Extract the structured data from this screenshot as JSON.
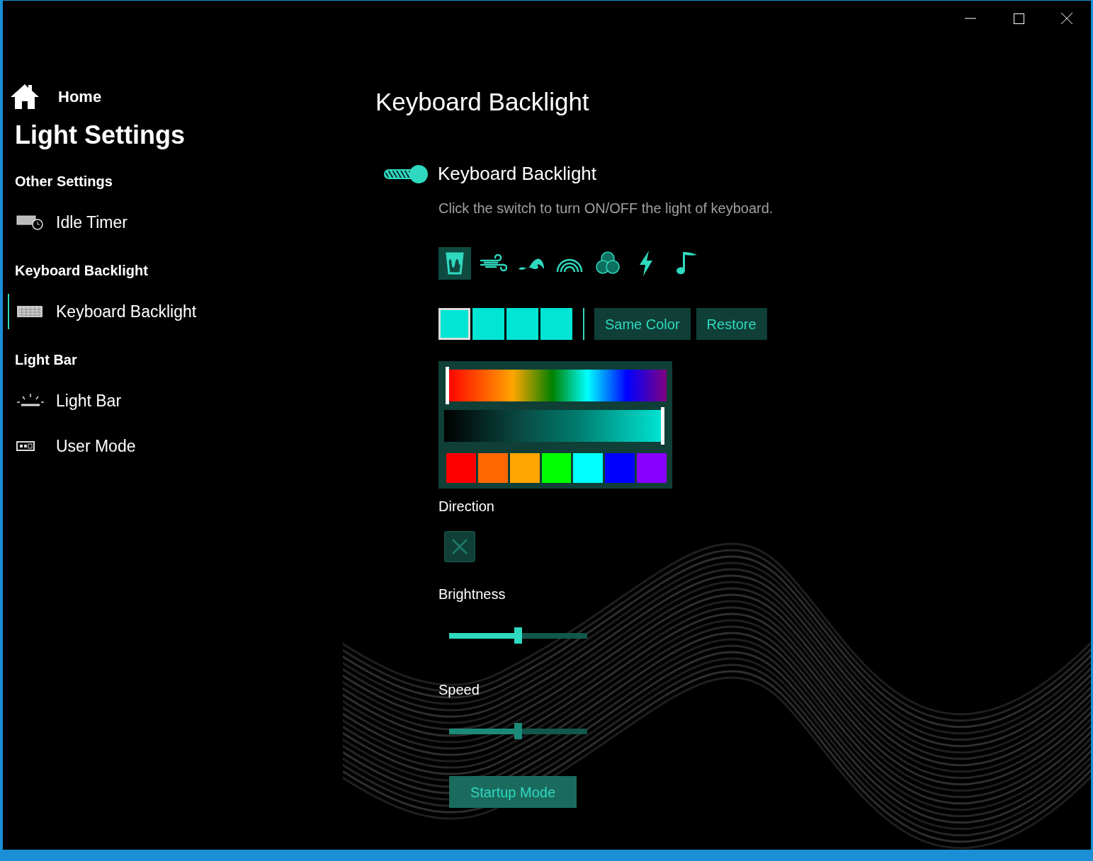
{
  "sidebar": {
    "home": "Home",
    "title": "Light Settings",
    "sections": [
      {
        "heading": "Other Settings",
        "items": [
          {
            "label": "Idle Timer",
            "kind": "timer",
            "selected": false
          }
        ]
      },
      {
        "heading": "Keyboard Backlight",
        "items": [
          {
            "label": "Keyboard Backlight",
            "kind": "keyboard",
            "selected": true
          }
        ]
      },
      {
        "heading": "Light Bar",
        "items": [
          {
            "label": "Light Bar",
            "kind": "lightbar",
            "selected": false
          },
          {
            "label": "User Mode",
            "kind": "usermode",
            "selected": false
          }
        ]
      }
    ]
  },
  "page": {
    "title": "Keyboard Backlight",
    "switch": {
      "label": "Keyboard Backlight",
      "on": true,
      "description": "Click the switch to turn ON/OFF the light of keyboard."
    },
    "effects": [
      {
        "kind": "static",
        "selected": true
      },
      {
        "kind": "wind",
        "selected": false
      },
      {
        "kind": "wave",
        "selected": false
      },
      {
        "kind": "rainbow",
        "selected": false
      },
      {
        "kind": "circles",
        "selected": false
      },
      {
        "kind": "lightning",
        "selected": false
      },
      {
        "kind": "music",
        "selected": false
      }
    ],
    "zones": [
      {
        "color": "#00e5d4",
        "selected": true
      },
      {
        "color": "#00e5d4",
        "selected": false
      },
      {
        "color": "#00e5d4",
        "selected": false
      },
      {
        "color": "#00e5d4",
        "selected": false
      }
    ],
    "buttons": [
      "Same Color",
      "Restore"
    ],
    "picker": {
      "hue": {
        "level": 0
      },
      "shade": {
        "level": 1
      },
      "palette": [
        {
          "color": "#ff0000"
        },
        {
          "color": "#ff6600"
        },
        {
          "color": "#ffa500"
        },
        {
          "color": "#00ff00"
        },
        {
          "color": "#00ffff"
        },
        {
          "color": "#0000ff"
        },
        {
          "color": "#8800ff"
        }
      ]
    },
    "direction": {
      "label": "Direction",
      "disabled": true
    },
    "sliders": [
      {
        "label": "Brightness",
        "level": 0.5,
        "disabled": false
      },
      {
        "label": "Speed",
        "level": 0.5,
        "disabled": true
      }
    ],
    "startup_button": "Startup Mode"
  }
}
